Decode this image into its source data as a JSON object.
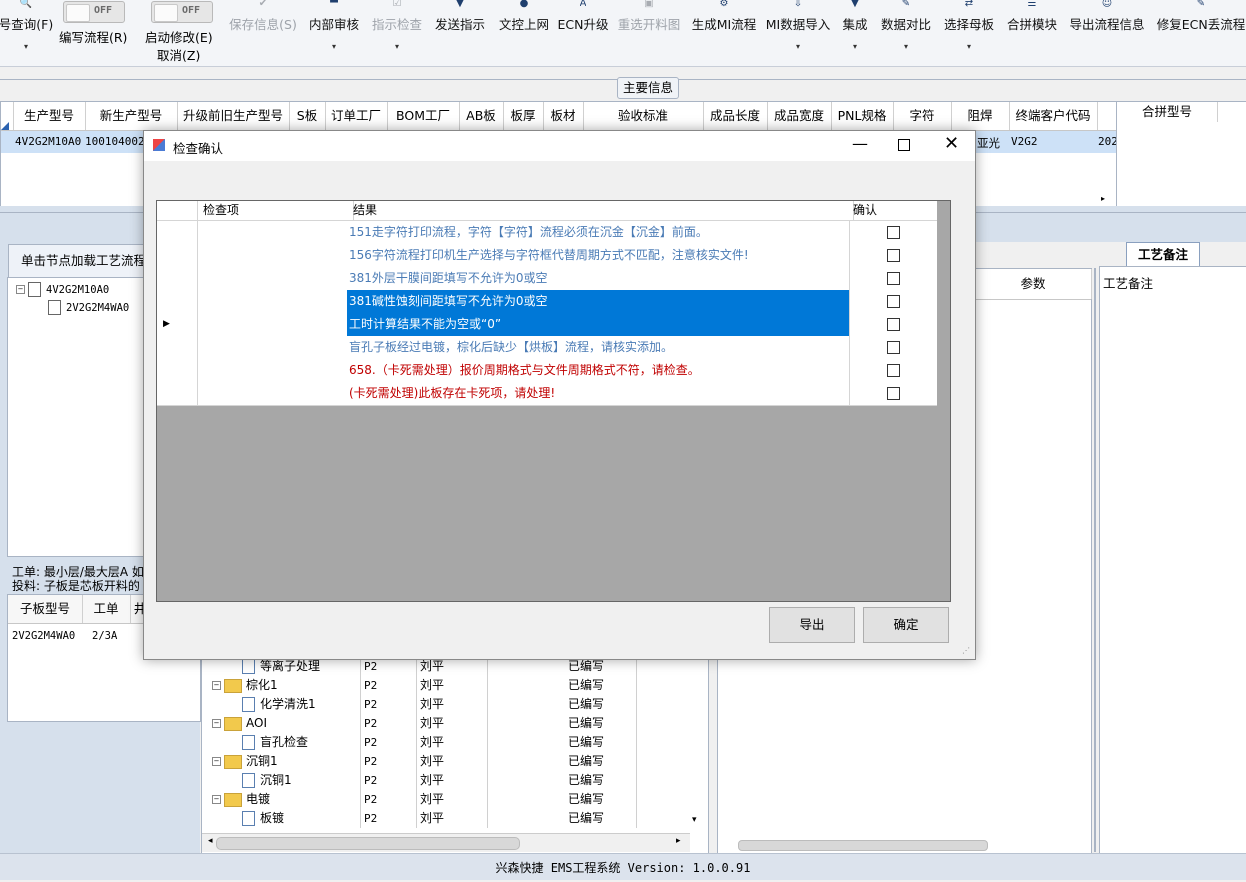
{
  "toolbar": {
    "query": "号查询(F)",
    "edit_flow": "编写流程(R)",
    "start_modify": "启动修改(E)",
    "cancel": "取消(Z)",
    "toggle1": "OFF",
    "toggle2": "OFF",
    "save_info": "保存信息(S)",
    "internal_review": "内部审核",
    "indicator_check": "指示检查",
    "send_indicator": "发送指示",
    "doc_online": "文控上网",
    "ecn_upgrade": "ECN升级",
    "reselect_chart": "重选开料图",
    "gen_mi_flow": "生成MI流程",
    "mi_import": "MI数据导入",
    "integrate": "集成",
    "data_compare": "数据对比",
    "select_template": "选择母板",
    "merge_module": "合拼模块",
    "export_flow": "导出流程信息",
    "fix_ecn": "修复ECN丢流程"
  },
  "main_info_label": "主要信息",
  "main_grid": {
    "headers": [
      "生产型号",
      "新生产型号",
      "升级前旧生产型号",
      "S板",
      "订单工厂",
      "BOM工厂",
      "AB板",
      "板厚",
      "板材",
      "验收标准",
      "成品长度",
      "成品宽度",
      "PNL规格",
      "字符",
      "阻焊",
      "终端客户代码"
    ],
    "row": {
      "prod_no": "4V2G2M10A0",
      "new_prod_no": "1001040020",
      "solder": "亚光",
      "customer": "V2G2",
      "extra": "202"
    }
  },
  "merge_header": "合拼型号",
  "left_panel": {
    "load_flow": "单击节点加载工艺流程",
    "tree": [
      "4V2G2M10A0",
      "2V2G2M4WA0"
    ],
    "note1": "工单: 最小层/最大层A 如",
    "note2": "投料: 子板是芯板开料的",
    "sub_headers": [
      "子板型号",
      "工单",
      "井"
    ],
    "sub_row": [
      "2V2G2M4WA0",
      "2/3A"
    ]
  },
  "process_grid": {
    "rows": [
      {
        "name": "等离子处理",
        "type": "doc",
        "code": "P2",
        "person": "刘平",
        "status": "已编写"
      },
      {
        "name": "棕化1",
        "type": "folder",
        "code": "P2",
        "person": "刘平",
        "status": "已编写"
      },
      {
        "name": "化学清洗1",
        "type": "doc",
        "code": "P2",
        "person": "刘平",
        "status": "已编写"
      },
      {
        "name": "AOI",
        "type": "folder",
        "code": "P2",
        "person": "刘平",
        "status": "已编写"
      },
      {
        "name": "盲孔检查",
        "type": "doc",
        "code": "P2",
        "person": "刘平",
        "status": "已编写"
      },
      {
        "name": "沉铜1",
        "type": "folder",
        "code": "P2",
        "person": "刘平",
        "status": "已编写"
      },
      {
        "name": "沉铜1",
        "type": "doc",
        "code": "P2",
        "person": "刘平",
        "status": "已编写"
      },
      {
        "name": "电镀",
        "type": "folder",
        "code": "P2",
        "person": "刘平",
        "status": "已编写"
      },
      {
        "name": "板镀",
        "type": "doc",
        "code": "P2",
        "person": "刘平",
        "status": "已编写"
      }
    ]
  },
  "right_panel": {
    "param_header": "参数",
    "remark_tab": "工艺备注",
    "remark_label": "工艺备注"
  },
  "dialog": {
    "title": "检查确认",
    "col_item": "检查项",
    "col_result": "结果",
    "col_confirm": "确认",
    "rows": [
      {
        "result": "151走字符打印流程，字符【字符】流程必须在沉金【沉金】前面。",
        "color": "#4a7bb5",
        "selected": false
      },
      {
        "result": "156字符流程打印机生产选择与字符框代替周期方式不匹配，注意核实文件!",
        "color": "#4a7bb5",
        "selected": false
      },
      {
        "result": "381外层干膜间距填写不允许为0或空",
        "color": "#4a7bb5",
        "selected": false
      },
      {
        "result": "381碱性蚀刻间距填写不允许为0或空",
        "color": "#ffffff",
        "selected": true
      },
      {
        "result": "工时计算结果不能为空或“0”",
        "color": "#ffffff",
        "selected": true
      },
      {
        "result": "盲孔子板经过电镀，棕化后缺少【烘板】流程，请核实添加。",
        "color": "#4a7bb5",
        "selected": false
      },
      {
        "result": "658.（卡死需处理）报价周期格式与文件周期格式不符，请检查。",
        "color": "#c00000",
        "selected": false
      },
      {
        "result": "(卡死需处理)此板存在卡死项，请处理!",
        "color": "#c00000",
        "selected": false
      }
    ],
    "export_btn": "导出",
    "ok_btn": "确定"
  },
  "status_bar": "兴森快捷 EMS工程系统 Version: 1.0.0.91"
}
